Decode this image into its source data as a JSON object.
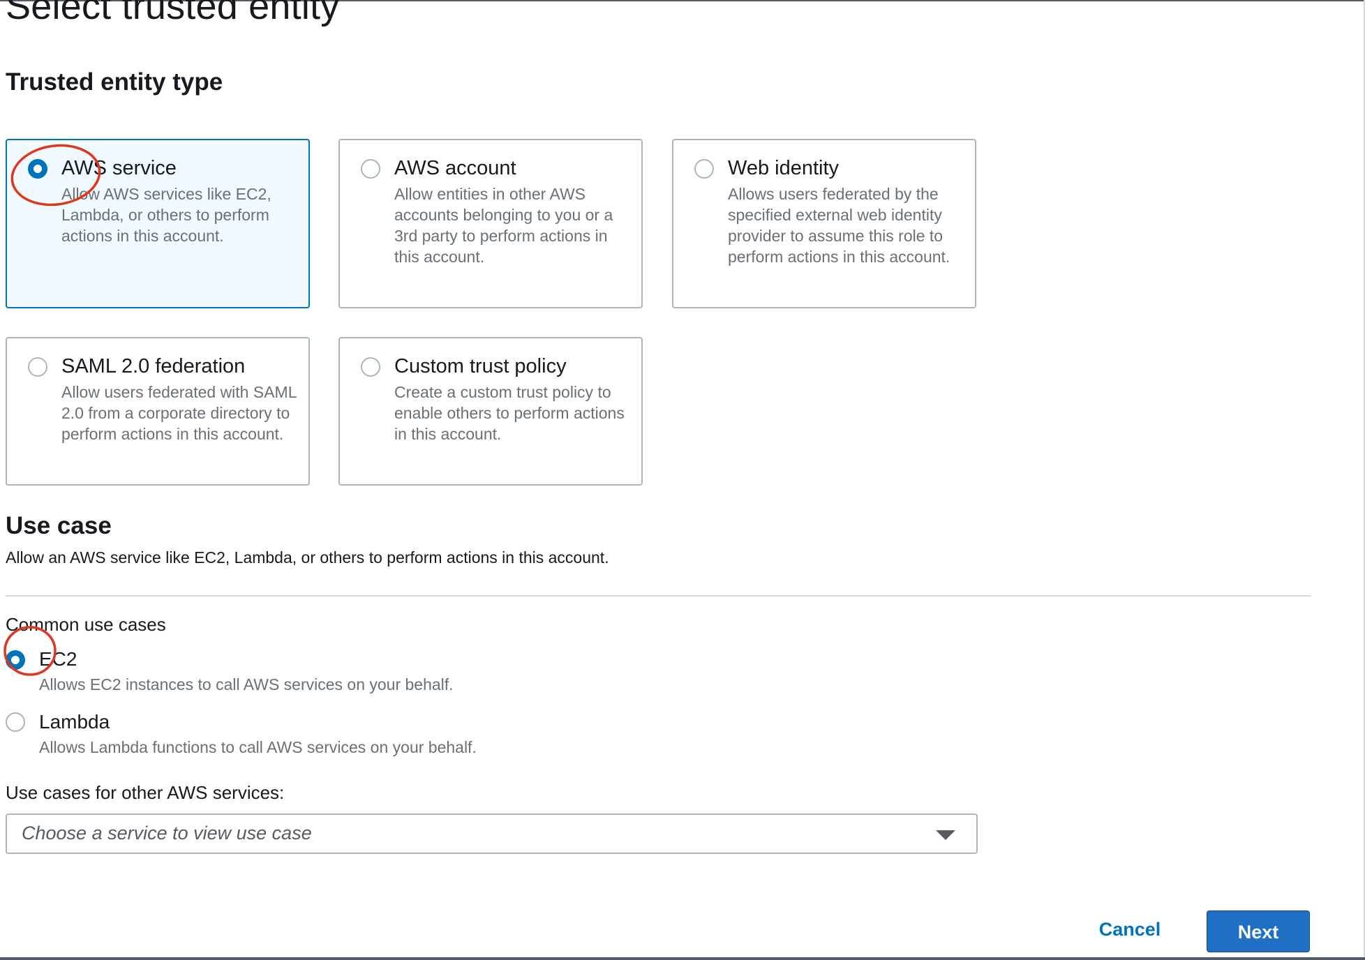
{
  "page_title": "Select trusted entity",
  "trusted_entity": {
    "heading": "Trusted entity type",
    "options": [
      {
        "title": "AWS service",
        "description": "Allow AWS services like EC2, Lambda, or others to perform actions in this account.",
        "selected": true
      },
      {
        "title": "AWS account",
        "description": "Allow entities in other AWS accounts belonging to you or a 3rd party to perform actions in this account.",
        "selected": false
      },
      {
        "title": "Web identity",
        "description": "Allows users federated by the specified external web identity provider to assume this role to perform actions in this account.",
        "selected": false
      },
      {
        "title": "SAML 2.0 federation",
        "description": "Allow users federated with SAML 2.0 from a corporate directory to perform actions in this account.",
        "selected": false
      },
      {
        "title": "Custom trust policy",
        "description": "Create a custom trust policy to enable others to perform actions in this account.",
        "selected": false
      }
    ]
  },
  "use_case": {
    "heading": "Use case",
    "description": "Allow an AWS service like EC2, Lambda, or others to perform actions in this account.",
    "common_label": "Common use cases",
    "options": [
      {
        "title": "EC2",
        "description": "Allows EC2 instances to call AWS services on your behalf.",
        "selected": true
      },
      {
        "title": "Lambda",
        "description": "Allows Lambda functions to call AWS services on your behalf.",
        "selected": false
      }
    ],
    "other_label": "Use cases for other AWS services:",
    "select_placeholder": "Choose a service to view use case"
  },
  "footer": {
    "cancel_label": "Cancel",
    "next_label": "Next"
  },
  "colors": {
    "accent": "#0073bb",
    "primary_button": "#1f6fc5",
    "annotation": "#e0351f"
  }
}
